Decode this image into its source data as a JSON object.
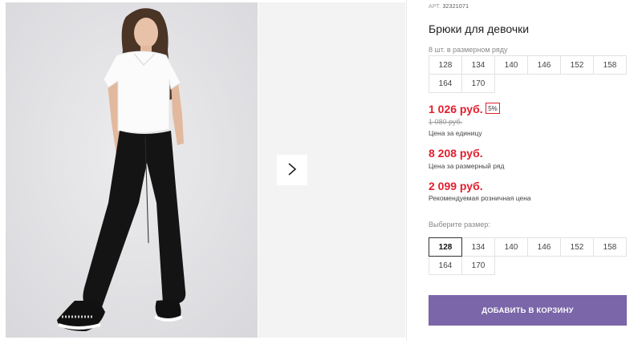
{
  "product": {
    "sku_label": "АРТ.",
    "sku_value": "32321071",
    "title": "Брюки для девочки"
  },
  "size_row": {
    "caption": "8 шт. в размерном ряду",
    "sizes": [
      "128",
      "134",
      "140",
      "146",
      "152",
      "158",
      "164",
      "170"
    ]
  },
  "pricing": {
    "unit_price": "1 026 руб.",
    "discount_badge": "5%",
    "old_price": "1 080 руб.",
    "unit_caption": "Цена за единицу",
    "row_price": "8 208 руб.",
    "row_caption": "Цена за размерный ряд",
    "rrp_price": "2 099 руб.",
    "rrp_caption": "Рекомендуемая розничная цена"
  },
  "size_select": {
    "caption": "Выберите размер:",
    "selected": "128",
    "sizes": [
      "128",
      "134",
      "140",
      "146",
      "152",
      "158",
      "164",
      "170"
    ]
  },
  "cart_button": {
    "label": "ДОБАВИТЬ В КОРЗИНУ"
  },
  "gallery": {
    "next_icon": "chevron-right-icon"
  },
  "colors": {
    "price_red": "#e21f2d",
    "cart_purple": "#7a66a8"
  }
}
